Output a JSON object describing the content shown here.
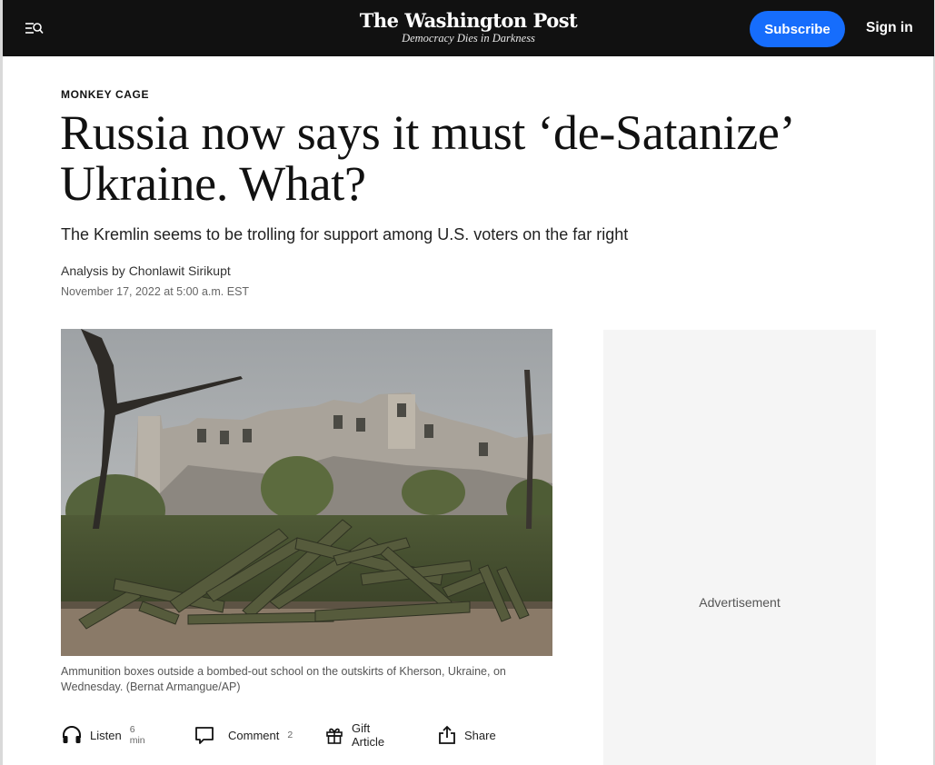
{
  "header": {
    "logo_name": "The Washington Post",
    "logo_tagline": "Democracy Dies in Darkness",
    "subscribe_label": "Subscribe",
    "signin_label": "Sign in",
    "colors": {
      "bar": "#111111",
      "subscribe": "#166dfc"
    },
    "menu_icon": "menu-search-icon"
  },
  "article": {
    "kicker": "MONKEY CAGE",
    "headline": "Russia now says it must ‘de-Satanize’ Ukraine. What?",
    "dek": "The Kremlin seems to be trolling for support among U.S. voters on the far right",
    "byline": "Analysis by Chonlawit Sirikupt",
    "date": "November 17, 2022 at 5:00 a.m. EST",
    "image_caption": "Ammunition boxes outside a bombed-out school on the outskirts of Kherson, Ukraine, on Wednesday. (Bernat Armangue/AP)"
  },
  "actions": {
    "listen": {
      "label": "Listen",
      "meta": "6 min",
      "icon": "headphones-icon"
    },
    "comment": {
      "label": "Comment",
      "meta": "2",
      "icon": "comment-icon"
    },
    "gift": {
      "label": "Gift Article",
      "icon": "gift-icon"
    },
    "share": {
      "label": "Share",
      "icon": "share-icon"
    }
  },
  "sidebar": {
    "ad_label": "Advertisement"
  }
}
